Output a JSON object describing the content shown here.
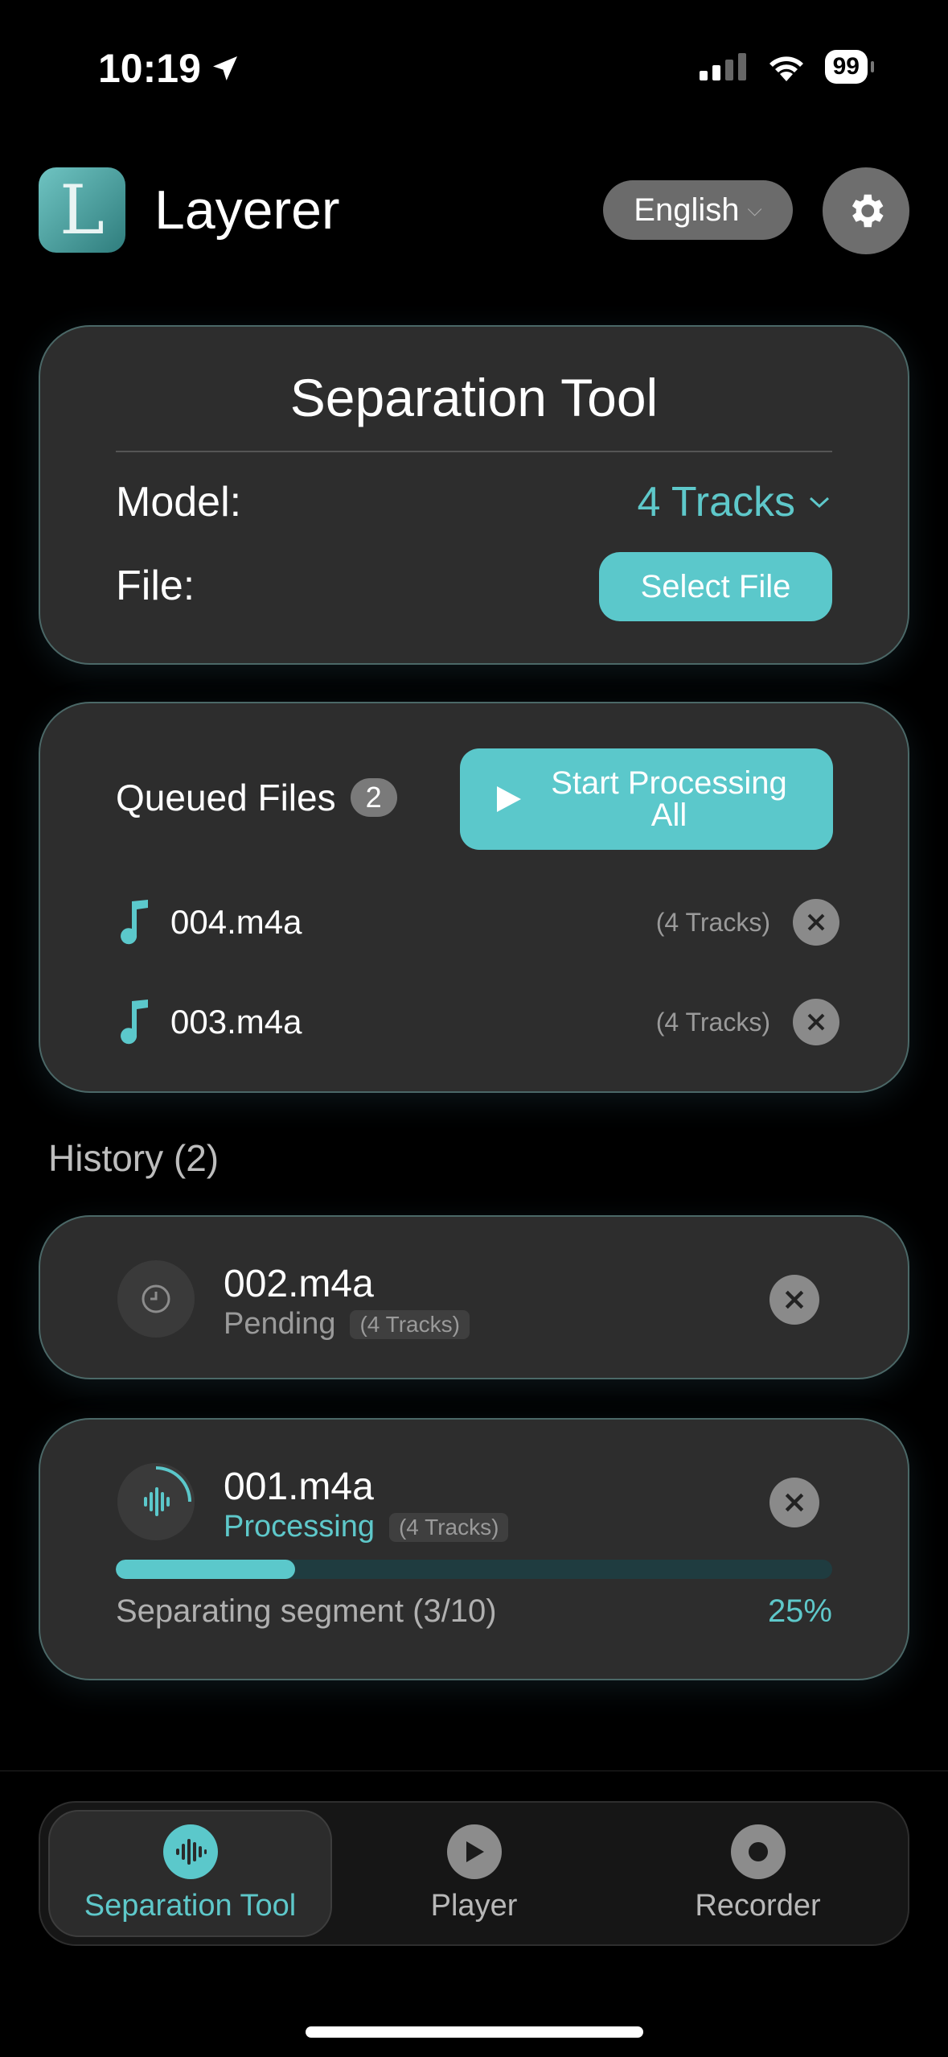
{
  "status": {
    "time": "10:19",
    "battery": "99"
  },
  "header": {
    "logo_letter": "L",
    "title": "Layerer",
    "language": "English"
  },
  "separation": {
    "title": "Separation Tool",
    "model_label": "Model:",
    "model_value": "4 Tracks",
    "file_label": "File:",
    "select_file": "Select File"
  },
  "queue": {
    "title": "Queued Files",
    "count": "2",
    "start_label": "Start Processing All",
    "items": [
      {
        "name": "004.m4a",
        "tracks": "(4 Tracks)"
      },
      {
        "name": "003.m4a",
        "tracks": "(4 Tracks)"
      }
    ]
  },
  "history": {
    "label": "History (2)",
    "items": [
      {
        "name": "002.m4a",
        "status": "Pending",
        "tracks": "(4 Tracks)"
      },
      {
        "name": "001.m4a",
        "status": "Processing",
        "tracks": "(4 Tracks)",
        "progress_text": "Separating segment (3/10)",
        "progress_pct": "25%",
        "progress_value": 0.25
      }
    ]
  },
  "tabs": [
    {
      "label": "Separation Tool",
      "icon": "waveform-icon",
      "active": true
    },
    {
      "label": "Player",
      "icon": "play-icon",
      "active": false
    },
    {
      "label": "Recorder",
      "icon": "record-icon",
      "active": false
    }
  ],
  "colors": {
    "accent": "#5bc8cb",
    "card": "#2d2d2d",
    "background": "#000000"
  }
}
